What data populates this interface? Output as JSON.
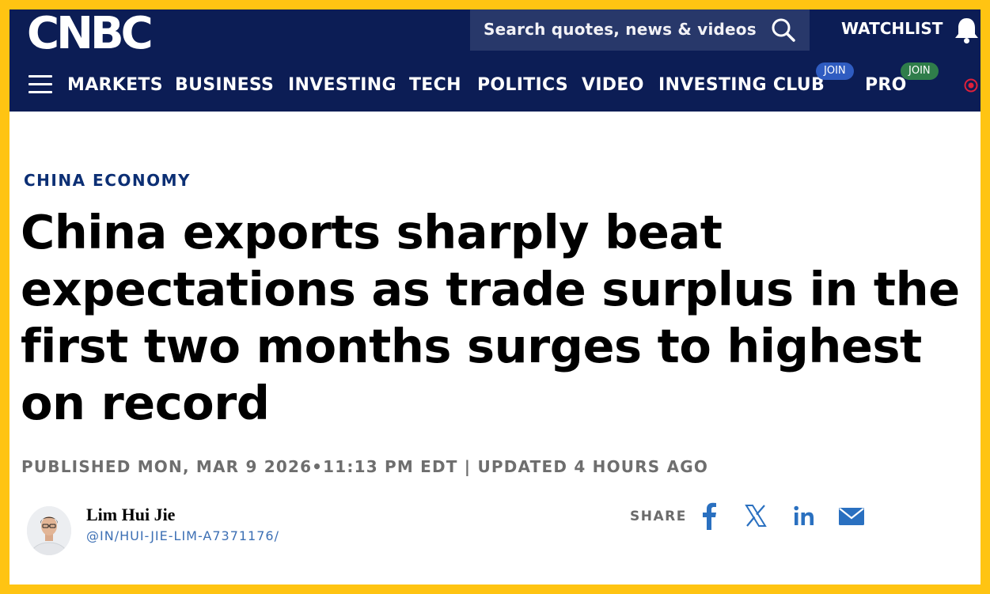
{
  "header": {
    "logo": "CNBC",
    "search_placeholder": "Search quotes, news & videos",
    "watchlist_label": "WATCHLIST",
    "nav": [
      {
        "label": "MARKETS"
      },
      {
        "label": "BUSINESS"
      },
      {
        "label": "INVESTING"
      },
      {
        "label": "TECH"
      },
      {
        "label": "POLITICS"
      },
      {
        "label": "VIDEO"
      },
      {
        "label": "INVESTING CLUB",
        "badge": "JOIN"
      },
      {
        "label": "PRO",
        "badge": "JOIN"
      }
    ]
  },
  "article": {
    "section": "CHINA ECONOMY",
    "headline": "China exports sharply beat expectations as trade surplus in the first two months surges to highest on record",
    "published": "PUBLISHED MON, MAR 9 2026•11:13 PM EDT | UPDATED 4 HOURS AGO",
    "author": {
      "name": "Lim Hui Jie",
      "handle": "@IN/HUI-JIE-LIM-A7371176/"
    },
    "share_label": "SHARE"
  },
  "colors": {
    "frame": "#ffc412",
    "header_bg": "#0c1d55",
    "search_bg": "#28386a",
    "section_label": "#0c2f74",
    "badge_blue": "#2f5cc1",
    "badge_green": "#2f7d4a",
    "share_icon": "#2a70c0",
    "live_dot": "#e0203a"
  },
  "icons": [
    "search-icon",
    "bell-icon",
    "menu-icon",
    "live-icon",
    "facebook-icon",
    "x-icon",
    "linkedin-icon",
    "email-icon"
  ]
}
